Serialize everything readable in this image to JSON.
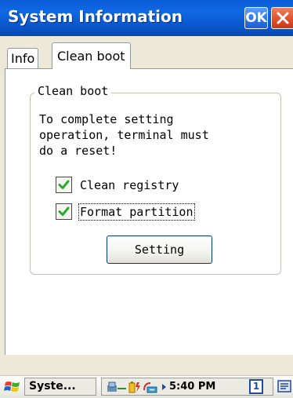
{
  "window": {
    "title": "System Information",
    "ok_label": "OK"
  },
  "tabs": [
    {
      "label": "Info",
      "selected": false
    },
    {
      "label": "Clean boot",
      "selected": true
    }
  ],
  "group": {
    "title": "Clean boot",
    "message": "To complete setting\noperation, terminal must\ndo a reset!",
    "options": [
      {
        "label": "Clean registry",
        "checked": true
      },
      {
        "label": "Format partition",
        "checked": true
      }
    ],
    "button_label": "Setting"
  },
  "taskbar": {
    "task_label": "Syste...",
    "clock": "5:40 PM",
    "desktop_number": "1",
    "icons": [
      "windows-start-icon",
      "network-icon",
      "battery-icon",
      "usb-sync-icon",
      "tray-arrow-icon",
      "keyboard-icon"
    ]
  },
  "colors": {
    "titlebar": "#0a5bd6",
    "check": "#2ea82e",
    "close": "#e0502c"
  }
}
